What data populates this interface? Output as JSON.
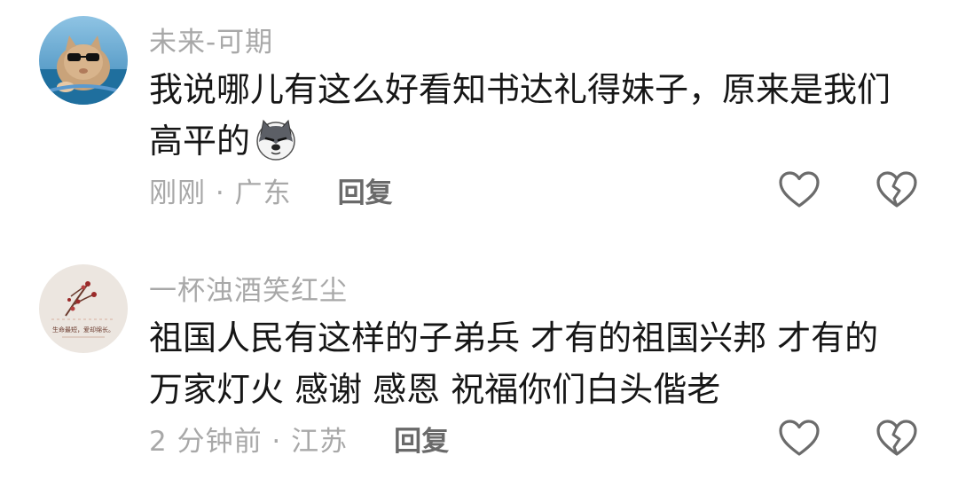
{
  "comments": [
    {
      "username": "未来-可期",
      "text": "我说哪儿有这么好看知书达礼得妹子，原来是我们高平的",
      "inline_emoji": "husky-dog-emoji",
      "time_location": "刚刚 · 广东",
      "reply_label": "回复",
      "avatar_icon": "cat-with-sunglasses-avatar"
    },
    {
      "username": "一杯浊酒笑红尘",
      "text": "祖国人民有这样的子弟兵 才有的祖国兴邦 才有的万家灯火  感谢 感恩 祝福你们白头偕老",
      "time_location": "2 分钟前 · 江苏",
      "reply_label": "回复",
      "avatar_icon": "cherry-branch-avatar",
      "avatar_text": "生命最短，爱却绵长。"
    }
  ],
  "icons": {
    "like": "heart-icon",
    "dislike": "broken-heart-icon"
  },
  "colors": {
    "username": "#a8a8a8",
    "body": "#161616",
    "reply": "#6a6a6a",
    "icon": "#6b6b6b"
  }
}
